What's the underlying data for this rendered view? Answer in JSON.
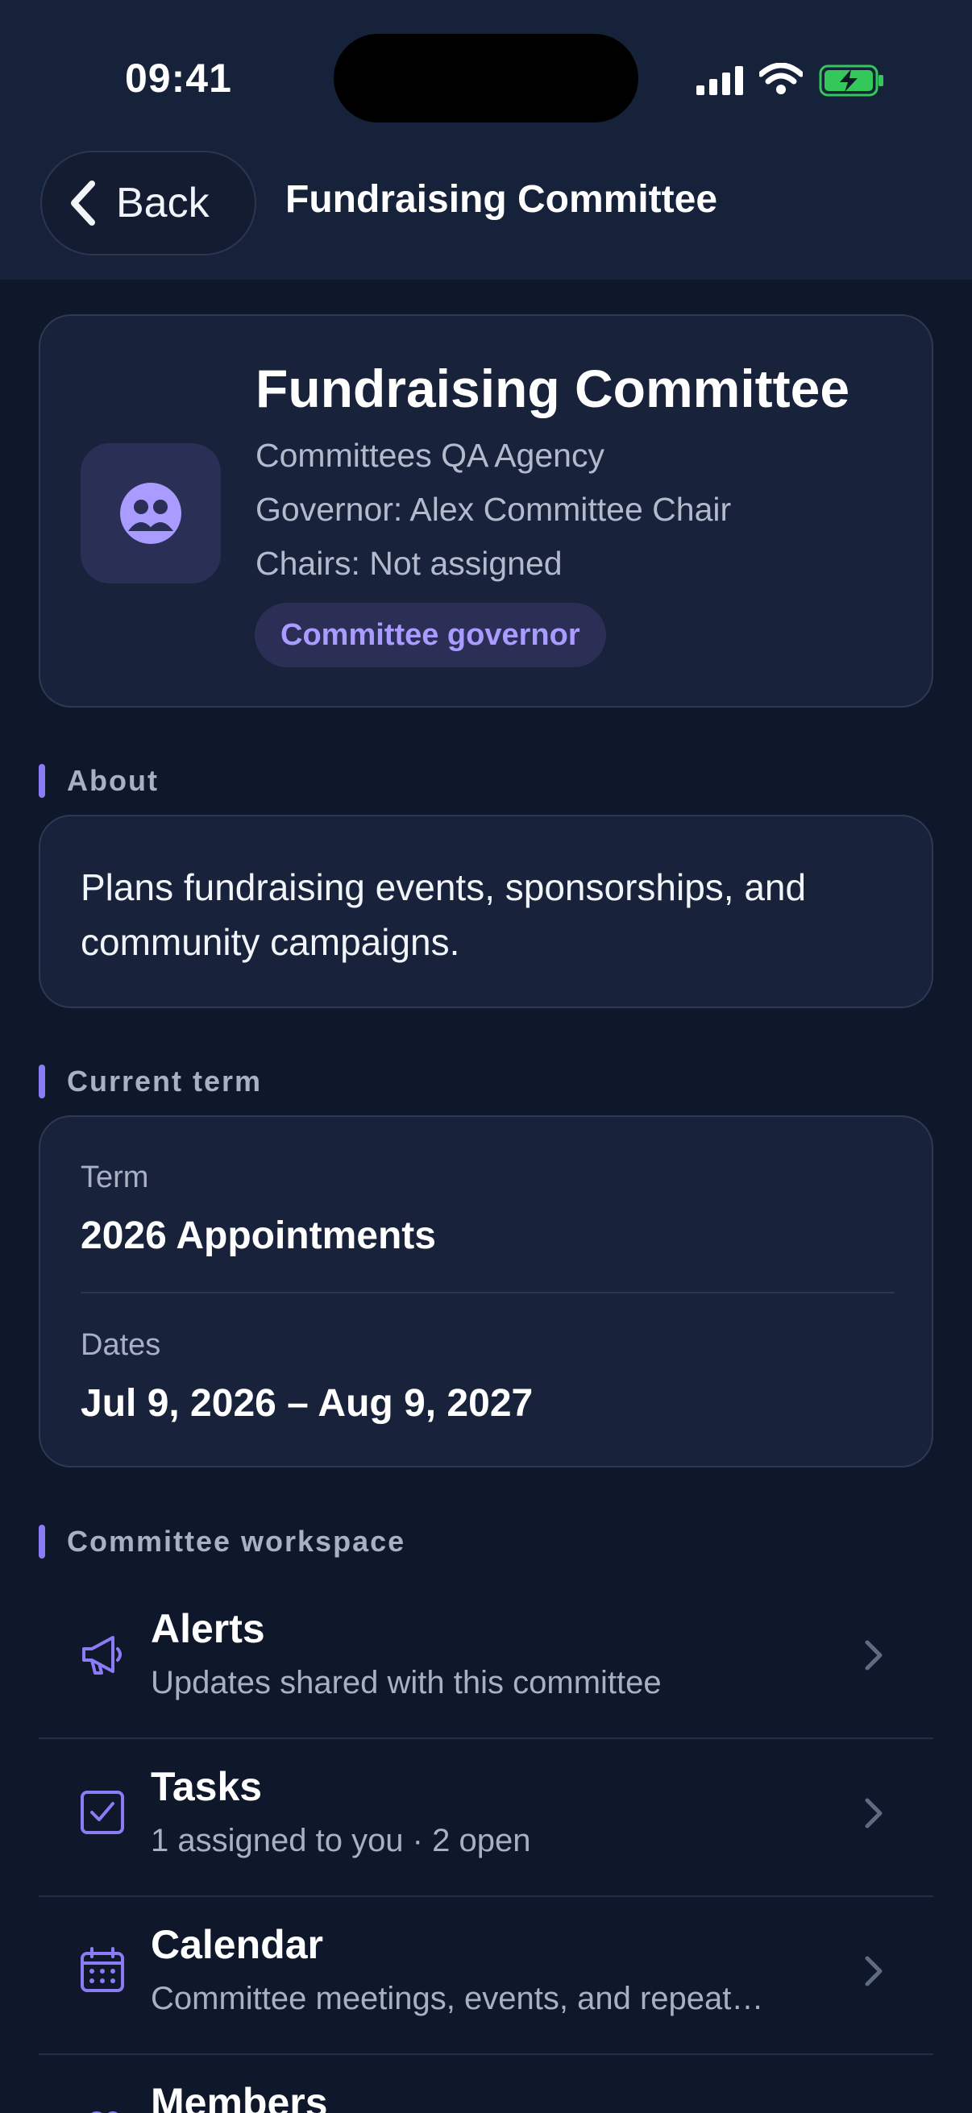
{
  "status_bar": {
    "time": "09:41",
    "icons": [
      "cellular-signal-icon",
      "wifi-icon",
      "battery-charging-icon"
    ]
  },
  "nav": {
    "back_label": "Back",
    "title": "Fundraising Committee"
  },
  "header": {
    "title": "Fundraising Committee",
    "agency": "Committees QA Agency",
    "governor": "Governor: Alex Committee Chair",
    "chairs": "Chairs: Not assigned",
    "role_badge": "Committee governor",
    "icon": "group-icon"
  },
  "about": {
    "section_label": "About",
    "text": "Plans fundraising events, sponsorships, and community campaigns."
  },
  "current_term": {
    "section_label": "Current term",
    "term_label": "Term",
    "term_value": "2026 Appointments",
    "dates_label": "Dates",
    "dates_value": "Jul 9, 2026 – Aug 9, 2027"
  },
  "workspace": {
    "section_label": "Committee workspace",
    "items": [
      {
        "title": "Alerts",
        "subtitle": "Updates shared with this committee",
        "icon": "megaphone-icon"
      },
      {
        "title": "Tasks",
        "subtitle": "1 assigned to you · 2 open",
        "icon": "checkbox-icon"
      },
      {
        "title": "Calendar",
        "subtitle": "Committee meetings, events, and repeat…",
        "icon": "calendar-icon"
      },
      {
        "title": "Members",
        "subtitle": "",
        "icon": "members-icon"
      }
    ]
  },
  "colors": {
    "background": "#0f172a",
    "card": "#18223a",
    "accent": "#8b7cf6",
    "battery_green": "#34c759"
  }
}
